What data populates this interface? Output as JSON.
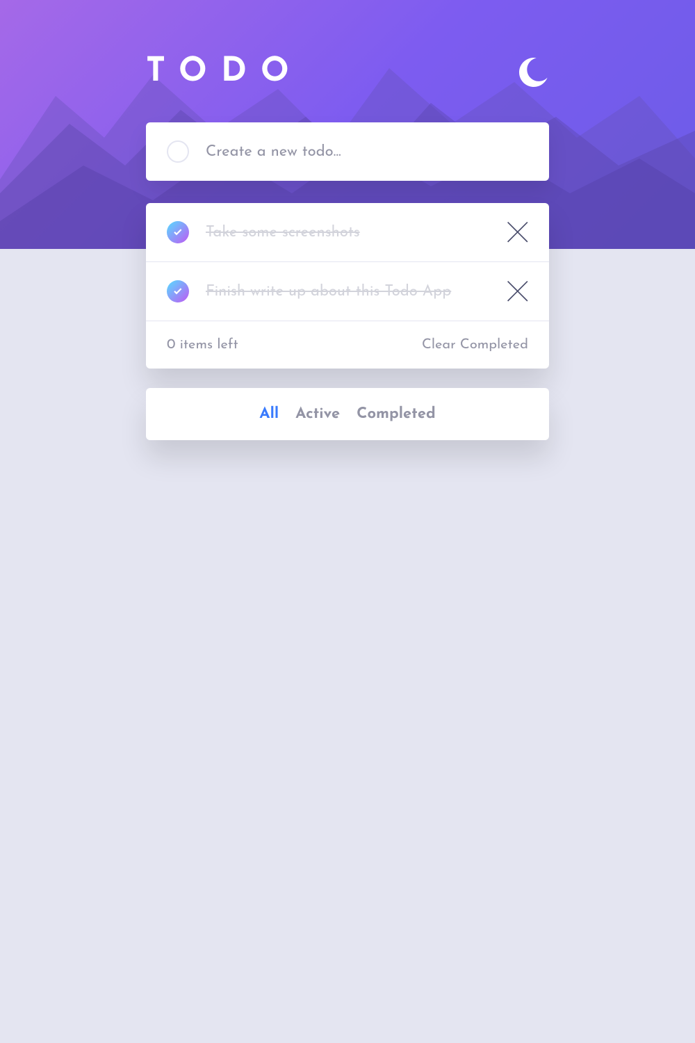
{
  "app": {
    "title": "TODO"
  },
  "input": {
    "placeholder": "Create a new todo..."
  },
  "todos": [
    {
      "text": "Take some screenshots",
      "completed": true
    },
    {
      "text": "Finish write up about this Todo App",
      "completed": true
    }
  ],
  "footer": {
    "items_left": "0 items left",
    "clear_label": "Clear Completed"
  },
  "filters": {
    "all": "All",
    "active": "Active",
    "completed": "Completed",
    "selected": "all"
  }
}
